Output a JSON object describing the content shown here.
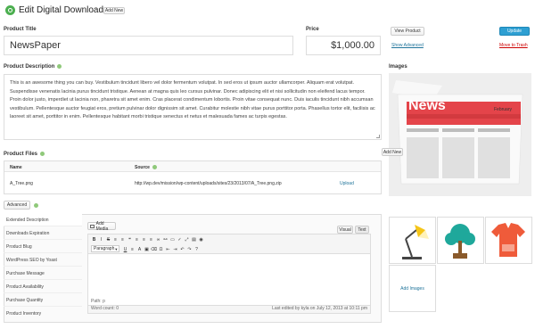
{
  "header": {
    "title": "Edit Digital Download",
    "add_new": "Add New"
  },
  "product_title": {
    "label": "Product Title",
    "value": "NewsPaper"
  },
  "price": {
    "label": "Price",
    "value": "$1,000.00"
  },
  "publish": {
    "view_product": "View Product",
    "update": "Update",
    "show_advanced": "Show Advanced",
    "move_to_trash": "Move to Trash"
  },
  "description": {
    "label": "Product Description",
    "text": "This is an awesome thing you can buy. Vestibulum tincidunt libero vel dolor fermentum volutpat. In sed eros ut ipsum auctor ullamcorper. Aliquam erat volutpat. Suspendisse venenatis lacinia purus tincidunt tristique. Aenean at magna quis leo cursus pulvinar. Donec adipiscing elit et nisi sollicitudin non eleifend lacus tempor. Proin dolor justo, imperdiet ut lacinia non, pharetra sit amet enim. Cras placerat condimentum lobortis. Proin vitae consequat nunc. Duis iaculis tincidunt nibh accumsan vestibulum. Pellentesque auctor feugiat eros, pretium pulvinar dolor dignissim sit amet. Curabitur molestie nibh vitae purus porttitor porta. Phasellus tortor elit, facilisis ac laoreet sit amet, porttitor in enim. Pellentesque habitant morbi tristique senectus et netus et malesuada fames ac turpis egestas."
  },
  "images": {
    "label": "Images",
    "news_title": "News",
    "news_month": "February",
    "add_images": "Add Images"
  },
  "files": {
    "label": "Product Files",
    "add_new": "Add New",
    "columns": {
      "name": "Name",
      "source": "Source"
    },
    "rows": [
      {
        "name": "A_Tree.png",
        "source": "http://wp.dev/mission/wp-content/uploads/sites/23/2013/07/A_Tree.png.zip",
        "action": "Upload"
      }
    ]
  },
  "advanced": {
    "button": "Advanced",
    "tabs": [
      "Extended Description",
      "Downloads Expiration",
      "Product Blug",
      "WordPress SEO by Yoast",
      "Purchase Message",
      "Product Availability",
      "Purchase Quantity",
      "Product Inventory"
    ],
    "editor": {
      "add_media": "Add Media",
      "tab_visual": "Visual",
      "tab_text": "Text",
      "format_select": "Paragraph",
      "path": "Path: p",
      "word_count": "Word count: 0",
      "last_edited": "Last edited by kyla on July 12, 2013 at 10:11 pm"
    }
  },
  "colors": {
    "accent_blue": "#2e9fd2",
    "trash_red": "#cc0000",
    "news_red": "#e4444a",
    "help_green": "#8fc97a"
  }
}
